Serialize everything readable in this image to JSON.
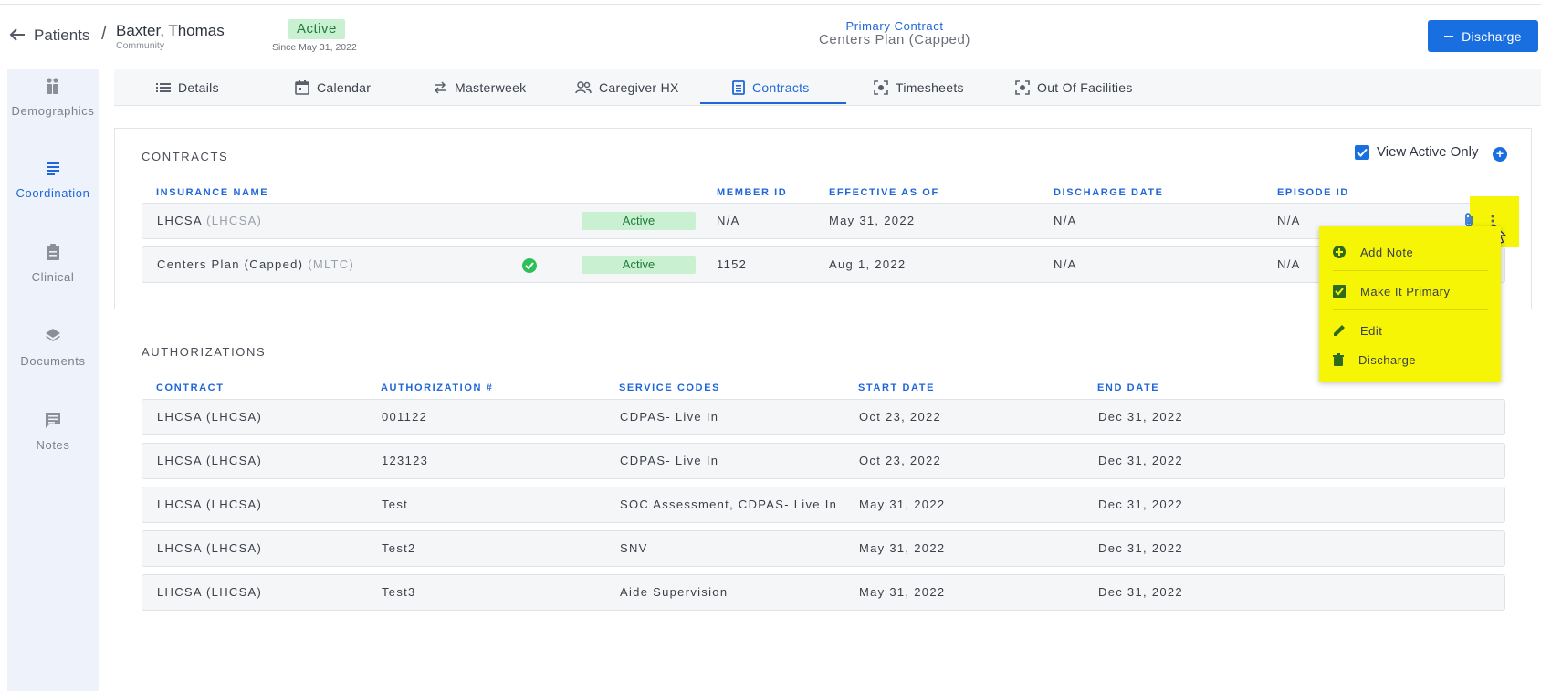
{
  "header": {
    "breadcrumb_root": "Patients",
    "separator": "/",
    "patient_name": "Baxter, Thomas",
    "patient_type": "Community",
    "status": "Active",
    "since": "Since May 31, 2022",
    "primary_contract_label": "Primary Contract",
    "primary_contract_value": "Centers Plan (Capped)",
    "discharge_label": "Discharge"
  },
  "sidebar": {
    "items": [
      {
        "label": "Demographics",
        "icon": "people-icon"
      },
      {
        "label": "Coordination",
        "icon": "list-icon",
        "active": true
      },
      {
        "label": "Clinical",
        "icon": "clipboard-icon"
      },
      {
        "label": "Documents",
        "icon": "layers-icon"
      },
      {
        "label": "Notes",
        "icon": "comment-icon"
      }
    ]
  },
  "tabs": [
    {
      "label": "Details",
      "icon": "list-icon"
    },
    {
      "label": "Calendar",
      "icon": "calendar-icon"
    },
    {
      "label": "Masterweek",
      "icon": "swap-icon"
    },
    {
      "label": "Caregiver HX",
      "icon": "people-icon"
    },
    {
      "label": "Contracts",
      "icon": "document-icon",
      "active": true
    },
    {
      "label": "Timesheets",
      "icon": "scan-icon"
    },
    {
      "label": "Out Of Facilities",
      "icon": "scan-icon"
    }
  ],
  "contracts": {
    "title": "CONTRACTS",
    "view_active_only": "View Active Only",
    "columns": [
      "INSURANCE NAME",
      "MEMBER ID",
      "EFFECTIVE AS OF",
      "DISCHARGE DATE",
      "EPISODE ID"
    ],
    "rows": [
      {
        "name": "LHCSA",
        "type": "(LHCSA)",
        "status": "Active",
        "member_id": "N/A",
        "effective": "May 31, 2022",
        "discharge": "N/A",
        "episode": "N/A",
        "primary": false
      },
      {
        "name": "Centers Plan (Capped)",
        "type": "(MLTC)",
        "status": "Active",
        "member_id": "1152",
        "effective": "Aug 1, 2022",
        "discharge": "N/A",
        "episode": "N/A",
        "primary": true
      }
    ]
  },
  "menu": {
    "items": [
      {
        "label": "Add Note",
        "icon": "plus-circle-icon"
      },
      {
        "label": "Make It Primary",
        "icon": "checkbox-icon"
      },
      {
        "label": "Edit",
        "icon": "pencil-icon"
      },
      {
        "label": "Discharge",
        "icon": "trash-icon"
      }
    ]
  },
  "authorizations": {
    "title": "AUTHORIZATIONS",
    "columns": [
      "CONTRACT",
      "AUTHORIZATION #",
      "SERVICE CODES",
      "START DATE",
      "END DATE"
    ],
    "rows": [
      {
        "contract": "LHCSA (LHCSA)",
        "auth": "001122",
        "codes": "CDPAS- Live In",
        "start": "Oct 23, 2022",
        "end": "Dec 31, 2022"
      },
      {
        "contract": "LHCSA (LHCSA)",
        "auth": "123123",
        "codes": "CDPAS- Live In",
        "start": "Oct 23, 2022",
        "end": "Dec 31, 2022"
      },
      {
        "contract": "LHCSA (LHCSA)",
        "auth": "Test",
        "codes": "SOC Assessment, CDPAS- Live In",
        "start": "May 31, 2022",
        "end": "Dec 31, 2022"
      },
      {
        "contract": "LHCSA (LHCSA)",
        "auth": "Test2",
        "codes": "SNV",
        "start": "May 31, 2022",
        "end": "Dec 31, 2022"
      },
      {
        "contract": "LHCSA (LHCSA)",
        "auth": "Test3",
        "codes": "Aide Supervision",
        "start": "May 31, 2022",
        "end": "Dec 31, 2022"
      }
    ]
  },
  "colors": {
    "accent": "#1a6fe0",
    "active_badge": "#c8f0d1",
    "highlight": "#f5f505"
  }
}
